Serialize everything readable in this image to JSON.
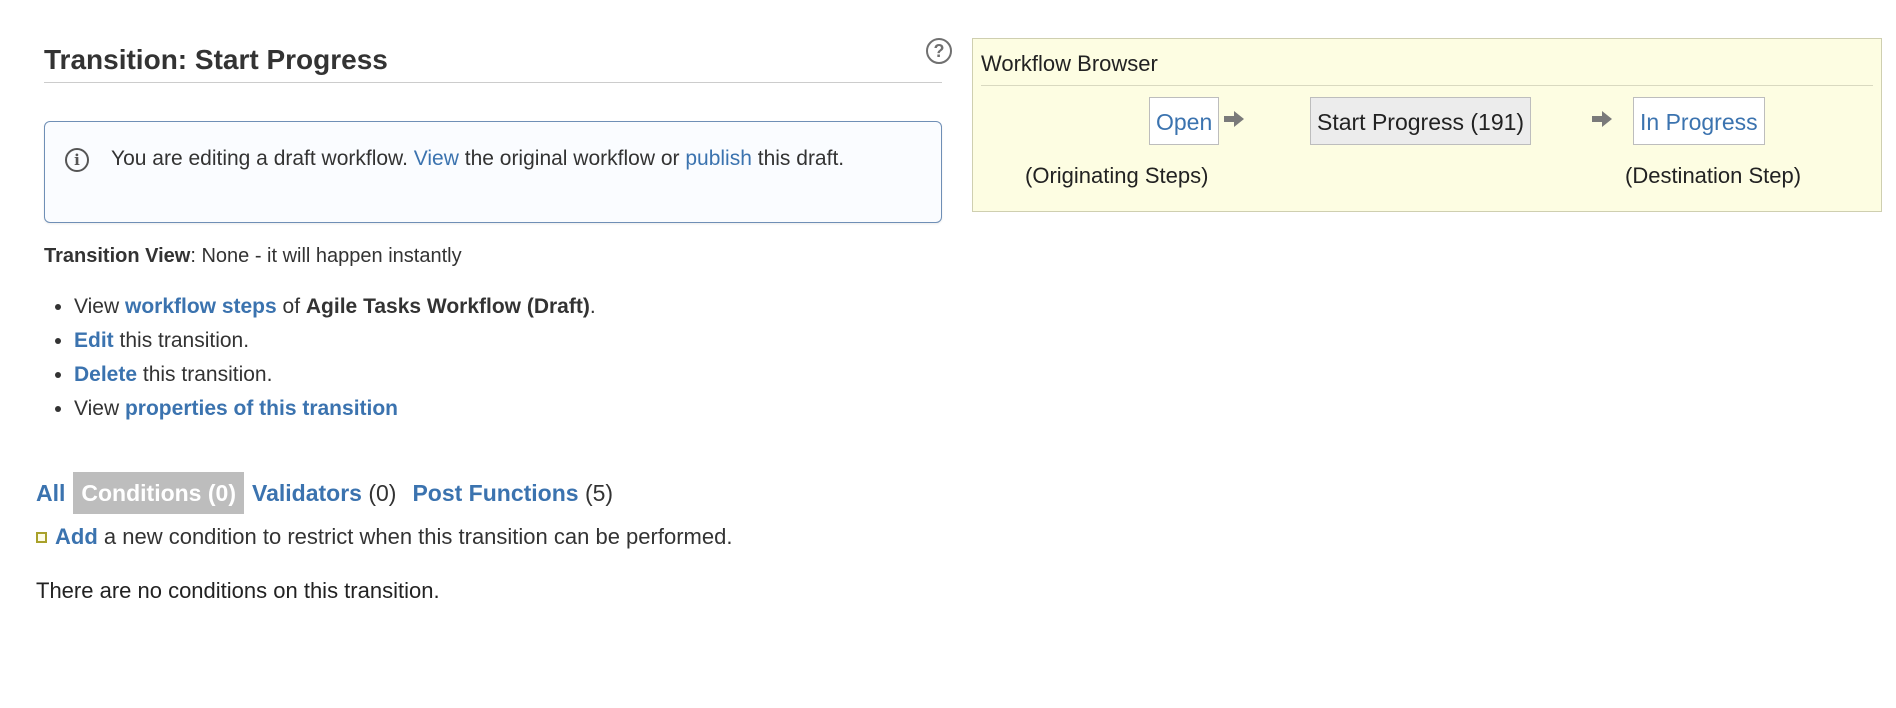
{
  "page": {
    "title": "Transition: Start Progress",
    "help_icon": "question-circle-icon"
  },
  "info_box": {
    "icon": "info-circle-icon",
    "text_before": "You are editing a draft workflow.",
    "view_link": "View",
    "text_mid": "the original workflow or",
    "publish_link": "publish",
    "text_after": "this draft."
  },
  "transition_view": {
    "label": "Transition View",
    "value": ": None - it will happen instantly"
  },
  "actions": [
    {
      "pre": "View",
      "link": "workflow steps",
      "mid": "of",
      "bold": "Agile Tasks Workflow (Draft)",
      "post": "."
    },
    {
      "link": "Edit",
      "post": "this transition."
    },
    {
      "link": "Delete",
      "post": "this transition."
    },
    {
      "pre": "View",
      "link": "properties of this transition"
    }
  ],
  "tabs": [
    {
      "name": "All",
      "count": "",
      "active": false
    },
    {
      "name": "Conditions",
      "count": "(0)",
      "active": true
    },
    {
      "name": "Validators",
      "count": "(0)",
      "active": false
    },
    {
      "name": "Post Functions",
      "count": "(5)",
      "active": false
    }
  ],
  "add_condition": {
    "link": "Add",
    "text": "a new condition to restrict when this transition can be performed."
  },
  "no_conditions": "There are no conditions on this transition.",
  "workflow_browser": {
    "title": "Workflow Browser",
    "origin_step": "Open",
    "transition": "Start Progress (191)",
    "destination_step": "In Progress",
    "origin_label": "(Originating Steps)",
    "destination_label": "(Destination Step)"
  },
  "colors": {
    "link": "#3b73af",
    "active_tab_bg": "#bdbdbd",
    "browser_bg": "#fdfde2"
  }
}
